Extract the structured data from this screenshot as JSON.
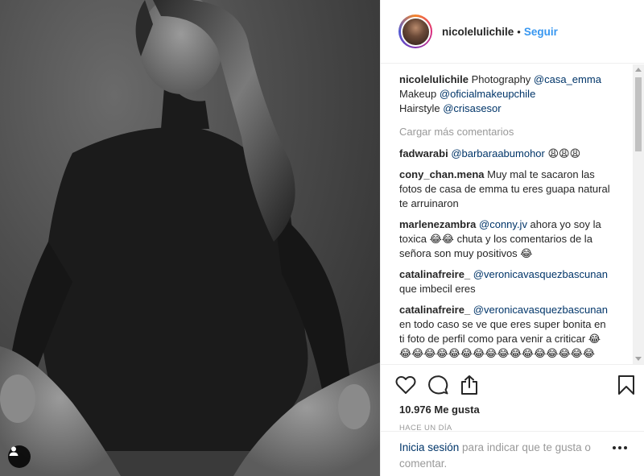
{
  "header": {
    "username": "nicolelulichile",
    "separator": "•",
    "follow_label": "Seguir"
  },
  "caption": {
    "username": "nicolelulichile",
    "line1_text": " Photography ",
    "line1_mention": "@casa_emma",
    "line2_text": "Makeup ",
    "line2_mention": "@oficialmakeupchile",
    "line3_text": "Hairstyle ",
    "line3_mention": "@crisasesor"
  },
  "load_more_label": "Cargar más comentarios",
  "comments": [
    {
      "username": "fadwarabi",
      "mention": "@barbaraabumohor",
      "text": " 😩😩😩"
    },
    {
      "username": "cony_chan.mena",
      "mention": "",
      "text": " Muy mal te sacaron las fotos de casa de emma tu eres guapa natural te arruinaron"
    },
    {
      "username": "marlenezambra",
      "mention": "@conny.jv",
      "text": " ahora yo soy la toxica 😂😂 chuta y los comentarios de la señora son muy positivos 😂"
    },
    {
      "username": "catalinafreire_",
      "mention": "@veronicavasquezbascunan",
      "text": " que imbecil eres"
    },
    {
      "username": "catalinafreire_",
      "mention": "@veronicavasquezbascunan",
      "text": " en todo caso se ve que eres super bonita en ti foto de perfil como para venir a criticar 😂😂😂😂😂😂😂😂😂😂😂😂😂😂😂😂😂"
    }
  ],
  "likes_label": "10.976 Me gusta",
  "time_label": "HACE UN DÍA",
  "login": {
    "link_label": "Inicia sesión",
    "rest_text": " para indicar que te gusta o comentar."
  },
  "icons": {
    "like": "heart-icon",
    "comment": "comment-icon",
    "share": "share-icon",
    "save": "bookmark-icon",
    "tag": "user-tag-icon",
    "more": "more-options-icon"
  },
  "colors": {
    "accent": "#3897f0",
    "link": "#003569",
    "muted": "#999999",
    "text": "#262626"
  }
}
